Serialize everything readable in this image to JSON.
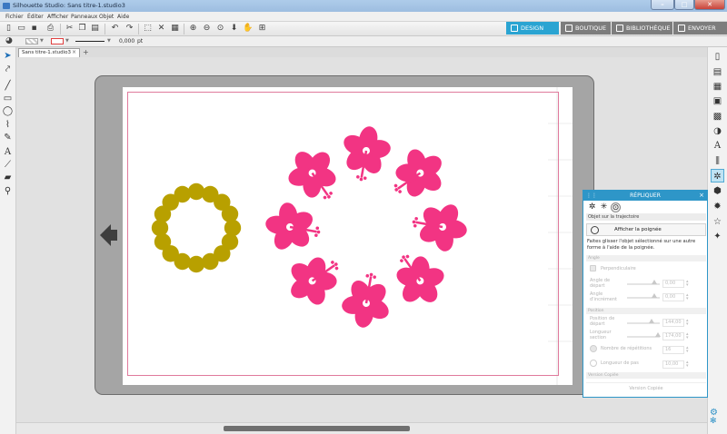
{
  "window": {
    "title": "Silhouette Studio: Sans titre-1.studio3"
  },
  "menu": [
    "Fichier",
    "Éditer",
    "Afficher",
    "Panneaux",
    "Objet",
    "Aide"
  ],
  "nav": {
    "design": "DESIGN",
    "boutique": "BOUTIQUE",
    "bibliotheque": "BIBLIOTHÈQUE",
    "envoyer": "ENVOYER",
    "active_color": "#2aa4d2"
  },
  "toolbar2": {
    "line_width": "0,000",
    "unit": "pt"
  },
  "document_tab": {
    "label": "Sans titre-1.studio3"
  },
  "canvas": {
    "circle_color": "#b8a000",
    "flower_color": "#f23483",
    "cut_border_color": "#e07a9c"
  },
  "panel": {
    "title": "RÉPLIQUER",
    "mode": "Objet sur la trajectoire",
    "show_handle": "Afficher la poignée",
    "description": "Faites glisser l'objet sélectionné sur une autre forme à l'aide de la poignée.",
    "section_angle": "Angle",
    "perpendicular": "Perpendiculaire",
    "start_angle_label": "Angle de départ",
    "start_angle_value": "0,00",
    "step_angle_label": "Angle d'incrément",
    "step_angle_value": "0,00",
    "section_position": "Position",
    "start_position_label": "Position de départ",
    "start_position_value": "144,00",
    "section_length_label": "Longueur section",
    "section_length_value": "174,00",
    "repetitions_label": "Nombre de répétitions",
    "repetitions_value": "16",
    "step_length_label": "Longueur de pas",
    "step_length_value": "10,00",
    "section_versions": "Version Copiée",
    "versions_button": "Version Copiée"
  }
}
